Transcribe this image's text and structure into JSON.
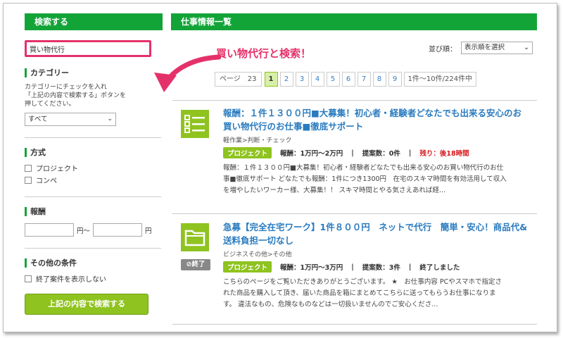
{
  "sidebar": {
    "title": "検索する",
    "search_value": "買い物代行",
    "category": {
      "title": "カテゴリー",
      "desc_line1": "カテゴリーにチェックを入れ",
      "desc_line2": "「上記の内容で検索する」ボタンを",
      "desc_line3": "押してください。",
      "select_value": "すべて"
    },
    "method": {
      "title": "方式",
      "options": [
        "プロジェクト",
        "コンペ"
      ]
    },
    "pay": {
      "title": "報酬",
      "unit_from": "円〜",
      "unit_to": "円"
    },
    "other": {
      "title": "その他の条件",
      "option": "終了案件を表示しない"
    },
    "submit_label": "上記の内容で検索する"
  },
  "main": {
    "title": "仕事情報一覧",
    "annotation": "買い物代行と検索！",
    "sort_label": "並び順：",
    "sort_value": "表示順を選択",
    "pager": {
      "label": "ページ　23",
      "pages": [
        "1",
        "2",
        "3",
        "4",
        "5",
        "6",
        "7",
        "8",
        "9"
      ],
      "current": "1",
      "count": "1件〜10件/224件中"
    },
    "jobs": [
      {
        "title_line1": "報酬：１件１３００円■大募集！初心者・経験者どなたでも出来る安心のお",
        "title_line2": "買い物代行のお仕事■徹底サポート",
        "category": "軽作業>判断・チェック",
        "type": "プロジェクト",
        "reward": "報酬：1万円〜2万円",
        "proposals": "提案数：0件",
        "status": "残り：後18時間",
        "desc_line1": "報酬：１件１３００円■大募集！初心者・経験者どなたでも出来る安心のお買い物代行のお仕",
        "desc_line2": "事■徹底サポート どなたでも報酬：1件につき1300円　在宅のスキマ時間を有効活用して収入",
        "desc_line3": "を増やしたいワーカー様、大募集！！ スキマ時間とやる気さえあれば経...",
        "icon": "checklist-icon"
      },
      {
        "title_line1": "急募【完全在宅ワーク】1件８００円　ネットで代行　簡単・安心！商品代&",
        "title_line2": "送料負担一切なし",
        "category": "ビジネスその他>その他",
        "type": "プロジェクト",
        "reward": "報酬：1万円〜3万円",
        "proposals": "提案数：3件",
        "status": "終了しました",
        "badge": "⊘終了",
        "desc_line1": "こちらのページをご覧いただきありがとうございます。 ★　お仕事内容 PCやスマホで指定さ",
        "desc_line2": "れた商品を購入して頂き、届いた商品を箱にまとめてこちらに送ってもらうお仕事になりま",
        "desc_line3": "す。 違法なもの、危険なものなどは一切扱いませんのでご安心くださ...",
        "icon": "folder-icon"
      }
    ]
  },
  "colors": {
    "green": "#13a438",
    "lime": "#8fc31f",
    "pink": "#e5316a",
    "link": "#2a7bbf",
    "red": "#d7191c"
  }
}
